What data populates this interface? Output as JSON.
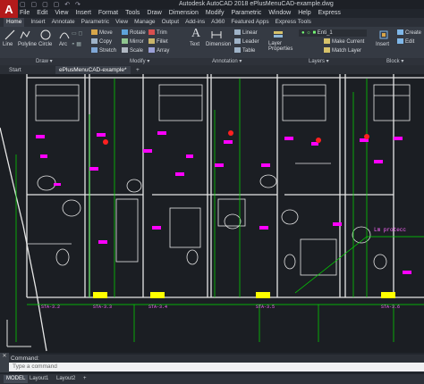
{
  "app": {
    "title": "Autodesk AutoCAD 2018   ePlusMenuCAD-example.dwg",
    "logo": "A",
    "quick_access": "▢ ▢ ▢ ▢ ↶ ↷"
  },
  "menubar": [
    "File",
    "Edit",
    "View",
    "Insert",
    "Format",
    "Tools",
    "Draw",
    "Dimension",
    "Modify",
    "Parametric",
    "Window",
    "Help",
    "Express"
  ],
  "ribbon_tabs": [
    "Home",
    "Insert",
    "Annotate",
    "Parametric",
    "View",
    "Manage",
    "Output",
    "Add-ins",
    "A360",
    "Featured Apps",
    "Express Tools"
  ],
  "ribbon": {
    "draw": {
      "line": "Line",
      "polyline": "Polyline",
      "circle": "Circle",
      "arc": "Arc"
    },
    "modify": {
      "move": "Move",
      "rotate": "Rotate",
      "trim": "Trim",
      "copy": "Copy",
      "mirror": "Mirror",
      "fillet": "Fillet",
      "stretch": "Stretch",
      "scale": "Scale",
      "array": "Array"
    },
    "annotation": {
      "text": "Text",
      "dimension": "Dimension",
      "linear": "Linear",
      "leader": "Leader",
      "table": "Table"
    },
    "layers": {
      "layer_properties": "Layer Properties",
      "layer_name": "Enti_1",
      "make_current": "Make Current",
      "match_layer": "Match Layer"
    },
    "block": {
      "insert": "Insert",
      "create": "Create",
      "edit": "Edit"
    },
    "panels": {
      "draw": "Draw ▾",
      "modify": "Modify ▾",
      "annotation": "Annotation ▾",
      "layers": "Layers ▾",
      "block": "Block ▾"
    }
  },
  "doc_tabs": [
    "Start",
    "ePlusMenuCAD-example*",
    "+"
  ],
  "drawing": {
    "room_tags": [
      "STA-3.3",
      "STA-3.4",
      "STA-3.5",
      "STA-3.6",
      "STA-3.2"
    ],
    "annotation_note": "Lm protecc"
  },
  "command": {
    "label": "Command:",
    "placeholder": "Type a command",
    "side": "✕"
  },
  "status_tabs": [
    "MODEL",
    "Layout1",
    "Layout2",
    "+"
  ],
  "colors": {
    "accent": "#00ff00",
    "magenta": "#ff00ff",
    "yellow": "#ffff00",
    "wall": "#e8e8e8",
    "background": "#1b1e23"
  }
}
